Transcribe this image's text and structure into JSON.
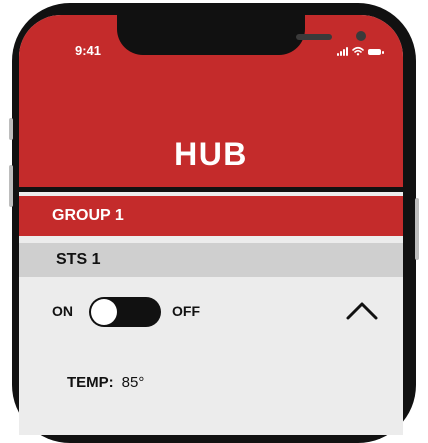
{
  "status_bar": {
    "time": "9:41",
    "icons": [
      "signal-icon",
      "wifi-icon",
      "battery-icon"
    ]
  },
  "header": {
    "title": "HUB"
  },
  "group": {
    "label": "GROUP 1"
  },
  "station": {
    "label": "STS 1",
    "toggle": {
      "on_label": "ON",
      "off_label": "OFF",
      "state": "on"
    },
    "collapse_icon": "chevron-up-icon"
  },
  "details": {
    "temp_label": "TEMP:",
    "temp_value": "85°"
  },
  "colors": {
    "accent": "#c42b2b",
    "frame": "#111111",
    "row_bg": "#cfcfcf",
    "screen_bg": "#ececec"
  }
}
